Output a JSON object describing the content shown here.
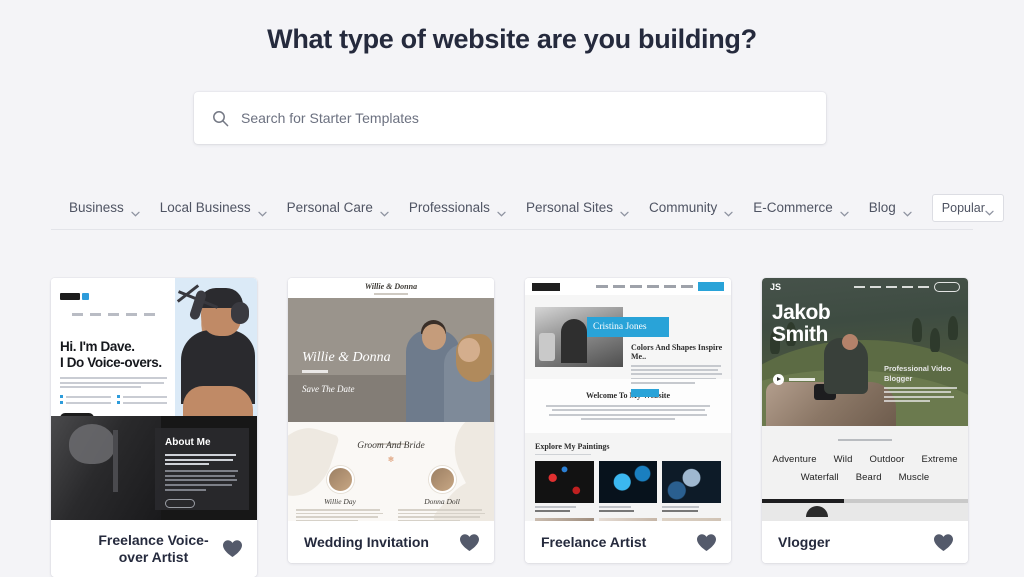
{
  "header": {
    "title": "What type of website are you building?"
  },
  "search": {
    "placeholder": "Search for Starter Templates",
    "value": "",
    "icon": "search-icon"
  },
  "filters": {
    "items": [
      {
        "label": "Business",
        "icon": "chevron-down-icon"
      },
      {
        "label": "Local Business",
        "icon": "chevron-down-icon"
      },
      {
        "label": "Personal Care",
        "icon": "chevron-down-icon"
      },
      {
        "label": "Professionals",
        "icon": "chevron-down-icon"
      },
      {
        "label": "Personal Sites",
        "icon": "chevron-down-icon"
      },
      {
        "label": "Community",
        "icon": "chevron-down-icon"
      },
      {
        "label": "E-Commerce",
        "icon": "chevron-down-icon"
      },
      {
        "label": "Blog",
        "icon": "chevron-down-icon"
      }
    ],
    "sort": {
      "selected": "Popular",
      "icon": "chevron-down-icon"
    }
  },
  "cards": [
    {
      "title": "Freelance Voice-over Artist",
      "favorite_icon": "heart-icon",
      "preview": {
        "heading_line1": "Hi. I'm Dave.",
        "heading_line2": "I Do Voice-overs.",
        "section_heading": "About Me"
      }
    },
    {
      "title": "Wedding Invitation",
      "favorite_icon": "heart-icon",
      "preview": {
        "brand": "Willie & Donna",
        "names": "Willie & Donna",
        "save_the_date": "Save The Date",
        "section_heading": "Groom And Bride",
        "person_left": "Willie Day",
        "person_right": "Donna Doll"
      }
    },
    {
      "title": "Freelance Artist",
      "favorite_icon": "heart-icon",
      "preview": {
        "banner_name": "Cristina Jones",
        "headline": "Colors And Shapes Inspire Me..",
        "section_heading": "Welcome To My Website",
        "gallery_heading": "Explore My Paintings",
        "accent_color": "#29a3d8"
      }
    },
    {
      "title": "Vlogger",
      "favorite_icon": "heart-icon",
      "preview": {
        "name_line1": "Jakob",
        "name_line2": "Smith",
        "role": "Professional Video Blogger",
        "tags_row1": [
          "Adventure",
          "Wild",
          "Outdoor",
          "Extreme"
        ],
        "tags_row2": [
          "Waterfall",
          "Beard",
          "Muscle"
        ]
      }
    }
  ],
  "colors": {
    "page_background": "#f4f4f7",
    "card_background": "#ffffff",
    "title_text": "#252a3d",
    "muted_text": "#4f5463",
    "heart": "#545a6b"
  }
}
